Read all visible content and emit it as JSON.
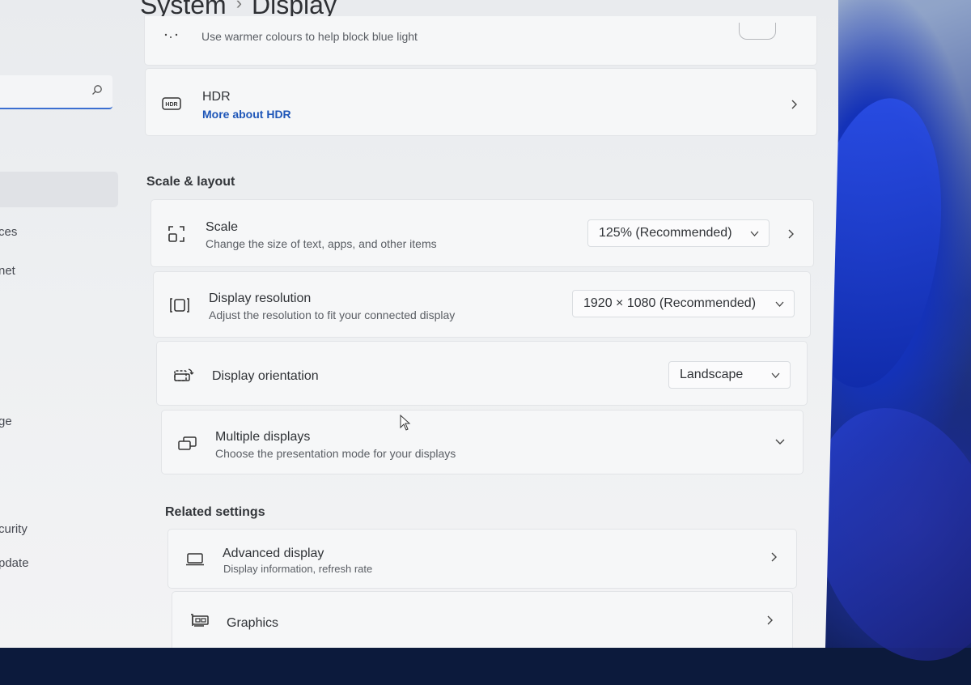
{
  "header": {
    "section": "System",
    "separator": "›",
    "page": "Display"
  },
  "sidebar": {
    "search_placeholder": "",
    "items": [
      {
        "label": "ces",
        "top": 0
      },
      {
        "label": "net"
      },
      {
        "label": "ge"
      },
      {
        "label": "curity"
      },
      {
        "label": "pdate"
      }
    ]
  },
  "night_light": {
    "subtitle": "Use warmer colours to help block blue light"
  },
  "hdr": {
    "title": "HDR",
    "link": "More about HDR"
  },
  "scale_layout": {
    "heading": "Scale & layout",
    "scale": {
      "title": "Scale",
      "subtitle": "Change the size of text, apps, and other items",
      "value": "125% (Recommended)"
    },
    "resolution": {
      "title": "Display resolution",
      "subtitle": "Adjust the resolution to fit your connected display",
      "value": "1920 × 1080 (Recommended)"
    },
    "orientation": {
      "title": "Display orientation",
      "value": "Landscape"
    },
    "multiple": {
      "title": "Multiple displays",
      "subtitle": "Choose the presentation mode for your displays"
    }
  },
  "related": {
    "heading": "Related settings",
    "advanced": {
      "title": "Advanced display",
      "subtitle": "Display information, refresh rate"
    },
    "graphics": {
      "title": "Graphics"
    }
  },
  "colors": {
    "accent": "#1e56b8",
    "search_underline": "#3b6fd1"
  }
}
